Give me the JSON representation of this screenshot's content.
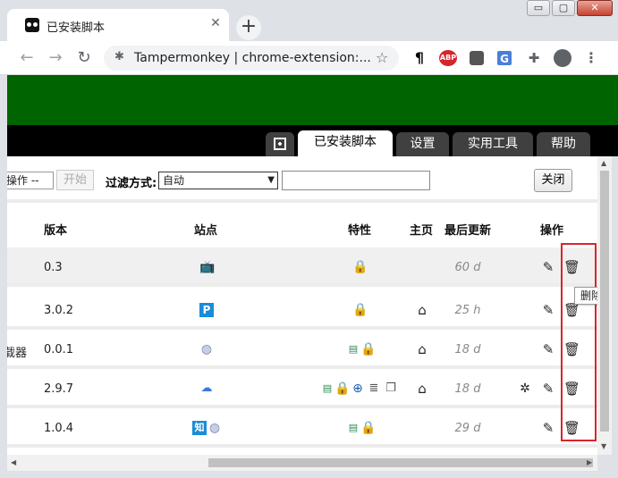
{
  "browser": {
    "tab_title": "已安装脚本",
    "tab_close": "✕",
    "new_tab": "+",
    "window_minimize": "▭",
    "window_restore": "▢",
    "window_close": "✕",
    "omnibox_text": "Tampermonkey | chrome-extension:...",
    "extensions": [
      "¶",
      "ABP",
      "tm",
      "G",
      "puzzle",
      "profile",
      "menu"
    ]
  },
  "page_tabs": {
    "installed": "已安装脚本",
    "settings": "设置",
    "utilities": "实用工具",
    "help": "帮助"
  },
  "filterbar": {
    "action_select": "操作 --",
    "start_button": "开始",
    "filter_label": "过滤方式:",
    "filter_value": "自动",
    "close_button": "关闭"
  },
  "table": {
    "headers": {
      "version": "版本",
      "sites": "站点",
      "features": "特性",
      "homepage": "主页",
      "last_updated": "最后更新",
      "actions": "操作"
    },
    "rows": [
      {
        "name": "",
        "version": "0.3",
        "updated": "60 d"
      },
      {
        "name": "",
        "version": "3.0.2",
        "updated": "25 h"
      },
      {
        "name": "载器",
        "version": "0.0.1",
        "updated": "18 d"
      },
      {
        "name": "",
        "version": "2.9.7",
        "updated": "18 d"
      },
      {
        "name": "",
        "version": "1.0.4",
        "updated": "29 d"
      }
    ]
  },
  "tooltip": "删除",
  "colors": {
    "banner": "#006400",
    "nav_bar": "#000000",
    "highlight_box": "#d9252b"
  }
}
